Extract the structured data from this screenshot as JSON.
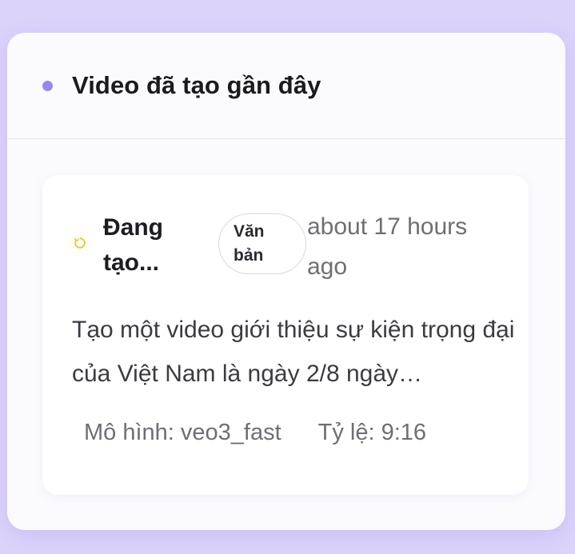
{
  "panel": {
    "title": "Video đã tạo gần đây",
    "accent_color": "#9b86f0"
  },
  "recent_video": {
    "status_icon": "loading-spinner-icon",
    "status_color": "#f2c417",
    "status_label": "Đang tạo...",
    "type_badge": "Văn bản",
    "timestamp": "about 17 hours ago",
    "prompt": "Tạo một video giới thiệu sự kiện trọng đại của Việt Nam là ngày 2/8 ngày…",
    "model": "Mô hình: veo3_fast",
    "ratio": "Tỷ lệ: 9:16"
  }
}
